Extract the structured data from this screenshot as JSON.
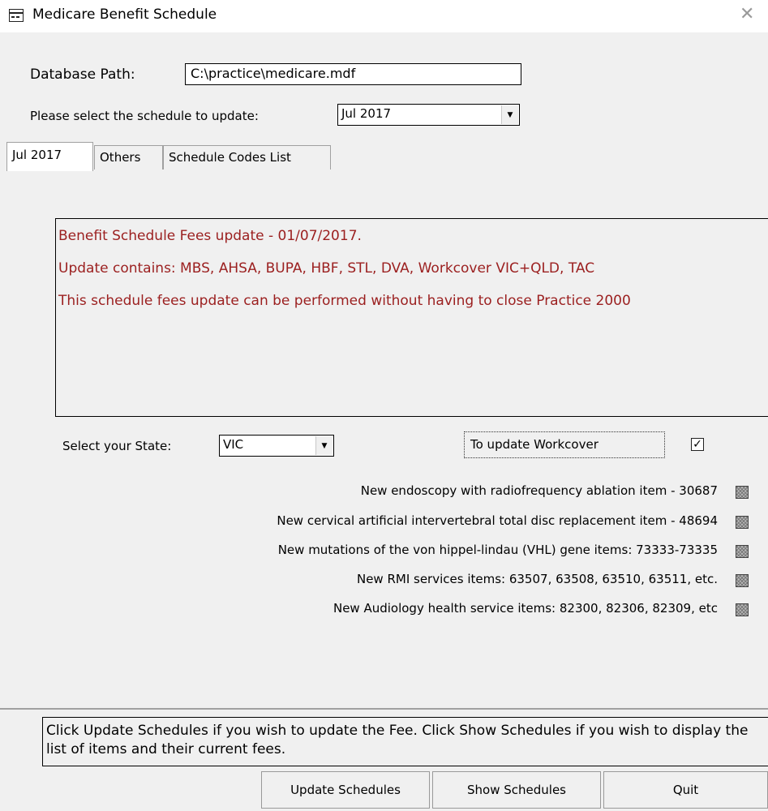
{
  "window": {
    "title": "Medicare Benefit Schedule",
    "close_glyph": "✕"
  },
  "database": {
    "label": "Database Path:",
    "value": "C:\\practice\\medicare.mdf"
  },
  "schedule": {
    "label": "Please select the schedule to update:",
    "selected": "Jul 2017"
  },
  "tabs": [
    {
      "label": "Jul 2017",
      "active": true
    },
    {
      "label": "Others",
      "active": false
    },
    {
      "label": "Schedule Codes List",
      "active": false
    }
  ],
  "info": {
    "line1": "Benefit Schedule Fees update - 01/07/2017.",
    "line2": "Update contains: MBS, AHSA, BUPA, HBF, STL, DVA, Workcover VIC+QLD, TAC",
    "line3": "This schedule fees update can be performed without having to close Practice 2000",
    "text_color": "#9b1f1f"
  },
  "state": {
    "label": "Select your State:",
    "selected": "VIC"
  },
  "workcover": {
    "label": "To update Workcover",
    "checked": true
  },
  "items": [
    {
      "label": "New endoscopy with radiofrequency ablation item - 30687"
    },
    {
      "label": "New cervical artificial intervertebral total disc replacement item - 48694"
    },
    {
      "label": "New mutations of the von hippel-lindau (VHL) gene items: 73333-73335"
    },
    {
      "label": "New RMI services items: 63507, 63508, 63510, 63511, etc."
    },
    {
      "label": "New Audiology health service items: 82300, 82306, 82309, etc"
    }
  ],
  "help_text": "Click Update Schedules if you wish to update the Fee. Click Show Schedules if you wish to display the list of items and their current fees.",
  "buttons": {
    "update": "Update Schedules",
    "show": "Show Schedules",
    "quit": "Quit"
  }
}
